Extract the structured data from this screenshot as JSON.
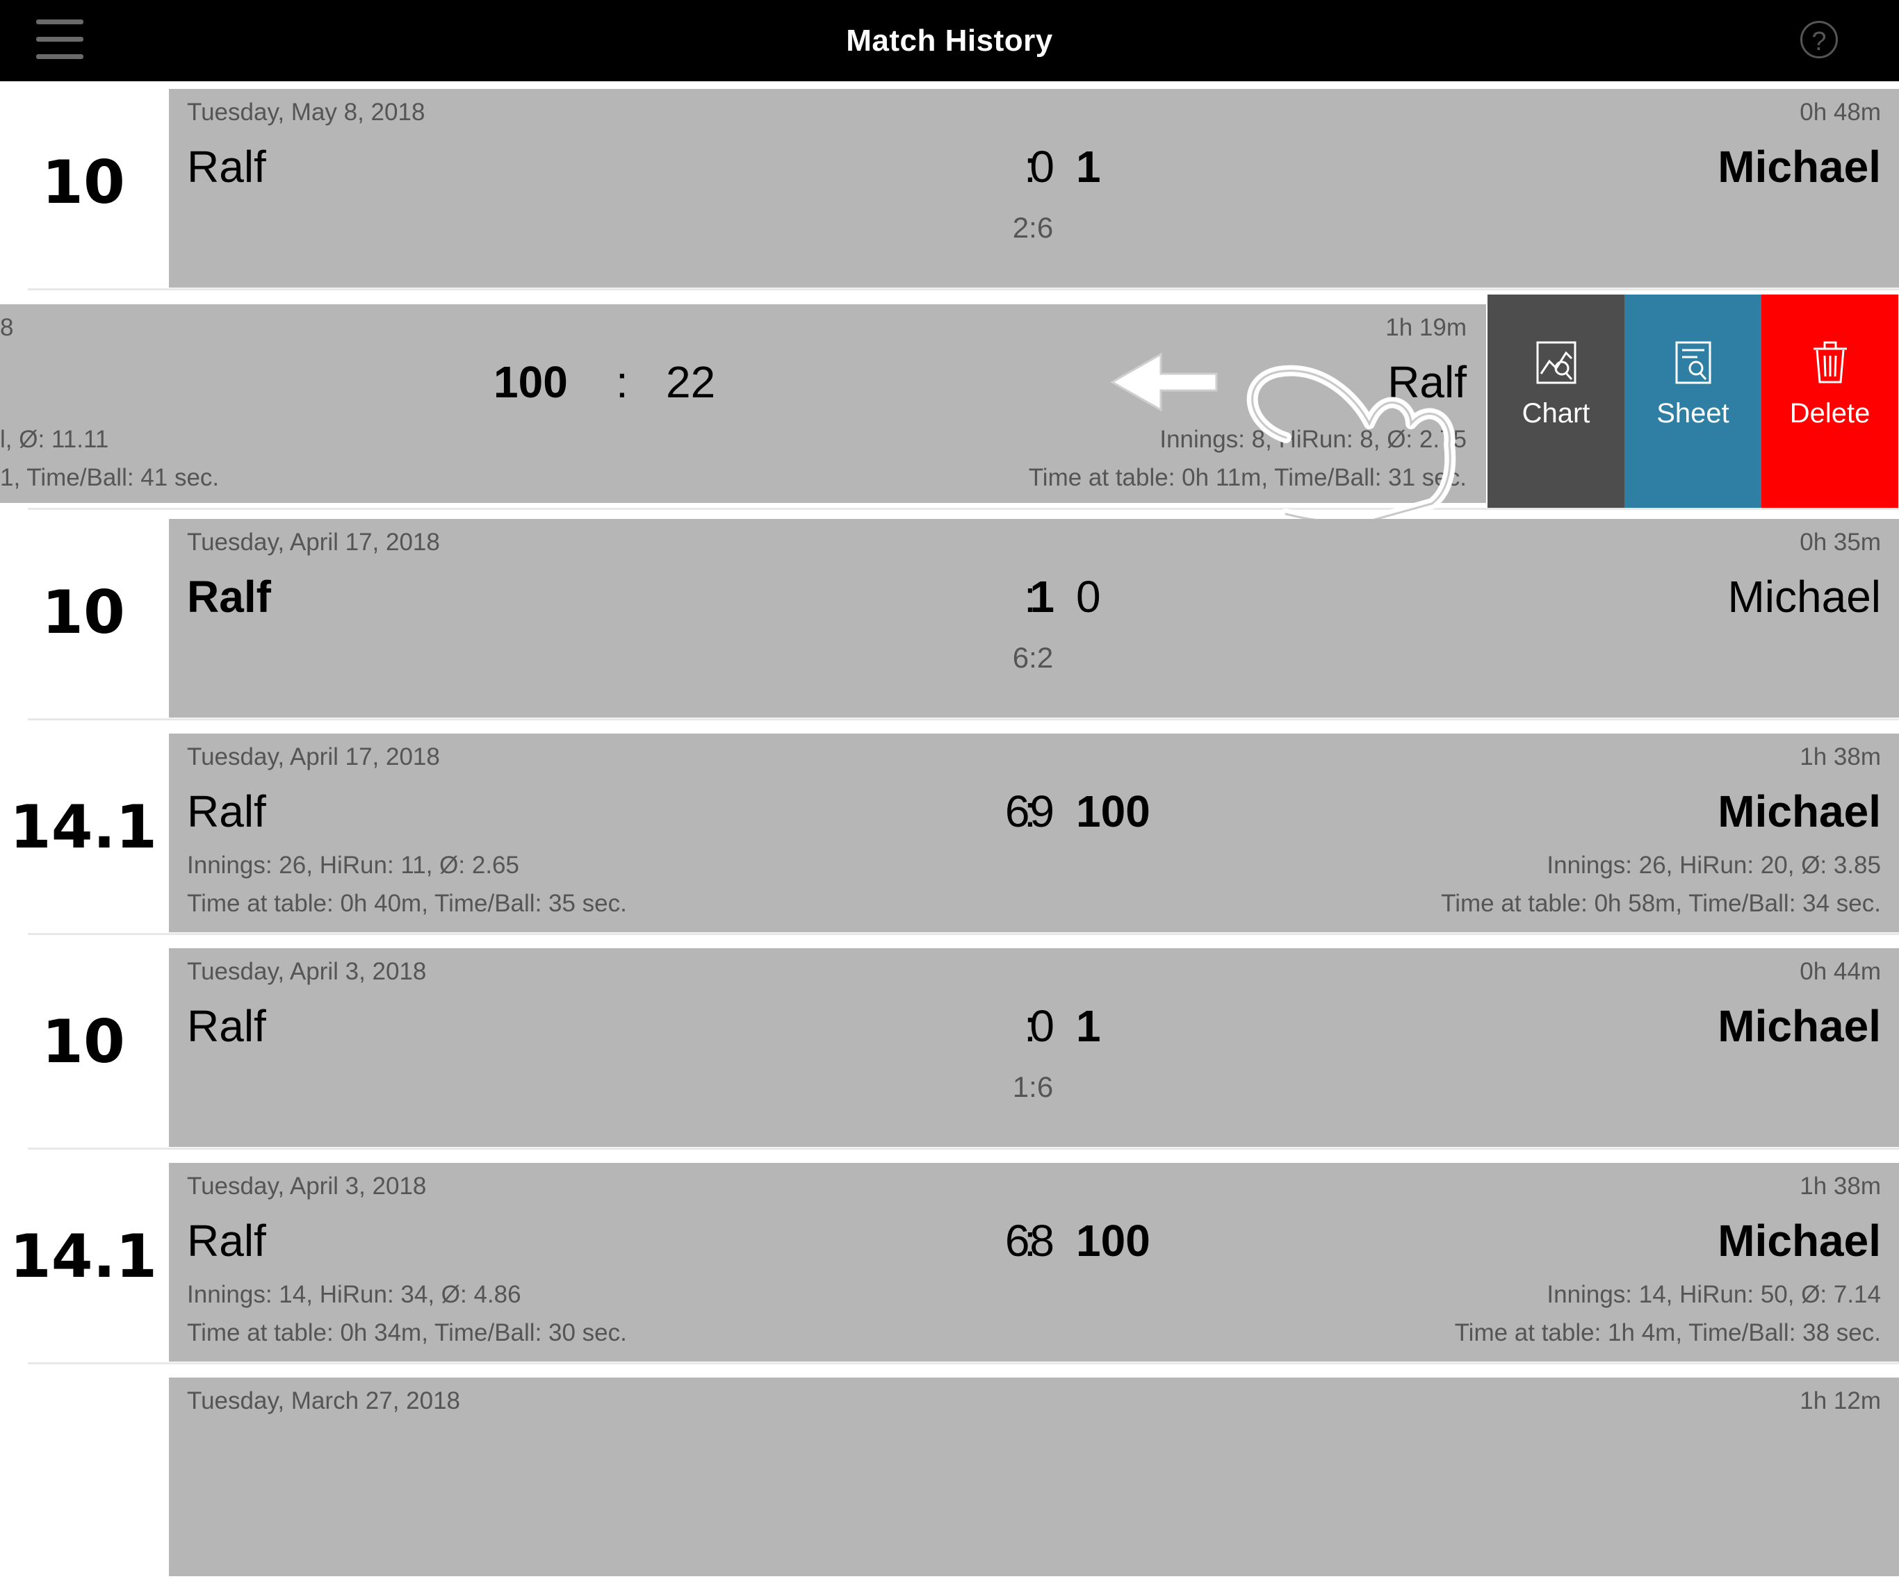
{
  "header": {
    "title": "Match History",
    "menu_icon": "hamburger-menu-icon",
    "help_icon": "help-circle-icon",
    "help_symbol": "?"
  },
  "matches": [
    {
      "game": "10",
      "date": "Tuesday, May 8, 2018",
      "duration": "0h 48m",
      "player1": "Ralf",
      "player2": "Michael",
      "score1": "0",
      "score2": "1",
      "winner": 2,
      "sub_score": "2:6"
    },
    {
      "swiped": true,
      "date_fragment": "8",
      "duration": "1h 19m",
      "score1": "100",
      "score2": "22",
      "player2": "Ralf",
      "stats1_line1": "l, Ø: 11.11",
      "stats1_line2": "1, Time/Ball: 41 sec.",
      "stats2_line1": "Innings: 8, HiRun: 8, Ø: 2.75",
      "stats2_line2": "Time at table: 0h 11m, Time/Ball: 31 sec.",
      "actions": [
        {
          "label": "Chart",
          "icon": "chart-icon",
          "color": "#4d4d4d"
        },
        {
          "label": "Sheet",
          "icon": "sheet-icon",
          "color": "#2e7fa3"
        },
        {
          "label": "Delete",
          "icon": "trash-icon",
          "color": "#ff0000"
        }
      ]
    },
    {
      "game": "10",
      "date": "Tuesday, April 17, 2018",
      "duration": "0h 35m",
      "player1": "Ralf",
      "player2": "Michael",
      "score1": "1",
      "score2": "0",
      "winner": 1,
      "sub_score": "6:2"
    },
    {
      "game": "14.1",
      "date": "Tuesday, April 17, 2018",
      "duration": "1h 38m",
      "player1": "Ralf",
      "player2": "Michael",
      "score1": "69",
      "score2": "100",
      "winner": 2,
      "stats1_line1": "Innings: 26, HiRun: 11, Ø: 2.65",
      "stats1_line2": "Time at table: 0h 40m, Time/Ball: 35 sec.",
      "stats2_line1": "Innings: 26, HiRun: 20, Ø: 3.85",
      "stats2_line2": "Time at table: 0h 58m, Time/Ball: 34 sec."
    },
    {
      "game": "10",
      "date": "Tuesday, April 3, 2018",
      "duration": "0h 44m",
      "player1": "Ralf",
      "player2": "Michael",
      "score1": "0",
      "score2": "1",
      "winner": 2,
      "sub_score": "1:6"
    },
    {
      "game": "14.1",
      "date": "Tuesday, April 3, 2018",
      "duration": "1h 38m",
      "player1": "Ralf",
      "player2": "Michael",
      "score1": "68",
      "score2": "100",
      "winner": 2,
      "stats1_line1": "Innings: 14, HiRun: 34, Ø: 4.86",
      "stats1_line2": "Time at table: 0h 34m, Time/Ball: 30 sec.",
      "stats2_line1": "Innings: 14, HiRun: 50, Ø: 7.14",
      "stats2_line2": "Time at table: 1h 4m, Time/Ball: 38 sec."
    },
    {
      "date": "Tuesday, March 27, 2018",
      "duration": "1h 12m"
    }
  ],
  "overlay": {
    "swipe_hint_icon": "swipe-left-hand-icon"
  }
}
